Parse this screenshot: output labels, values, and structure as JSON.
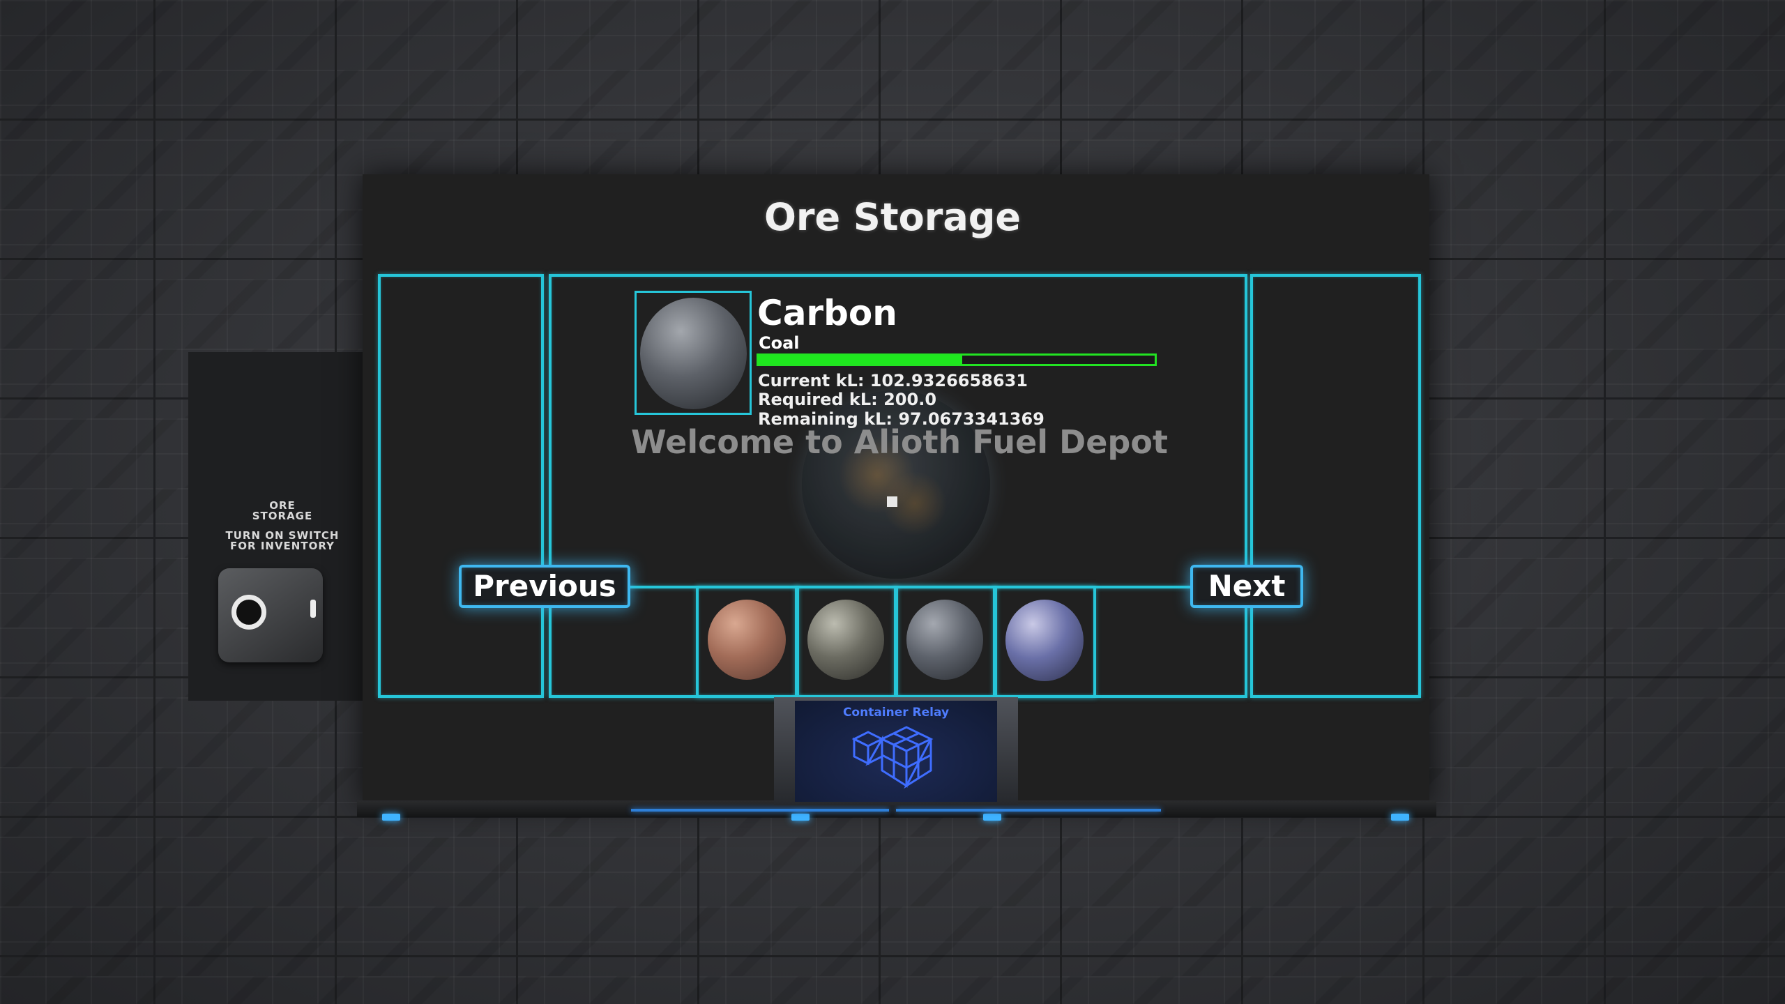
{
  "screen": {
    "title": "Ore Storage",
    "welcome_text": "Welcome to Alioth Fuel Depot"
  },
  "selected_ore": {
    "name": "Carbon",
    "subtype": "Coal",
    "fill_fraction": 0.5146,
    "current_text": "Current kL: 102.9326658631",
    "required_text": "Required kL: 200.0",
    "remaining_text": "Remaining kL: 97.0673341369"
  },
  "navigation": {
    "previous_label": "Previous",
    "next_label": "Next"
  },
  "ore_carousel": {
    "items": [
      {
        "icon": "copper-ore-sphere"
      },
      {
        "icon": "mottled-ore-sphere"
      },
      {
        "icon": "gray-ore-sphere"
      },
      {
        "icon": "blue-ore-sphere"
      }
    ]
  },
  "side_panel": {
    "line1": "ORE",
    "line2": "STORAGE",
    "line3": "TURN ON SWITCH",
    "line4": "FOR INVENTORY"
  },
  "relay": {
    "label": "Container Relay",
    "icon": "cubes-icon"
  },
  "colors": {
    "frame": "#26c6d9",
    "progress": "#1ee81e",
    "button_glow": "#3fb8f0",
    "relay_accent": "#4f7dff"
  }
}
